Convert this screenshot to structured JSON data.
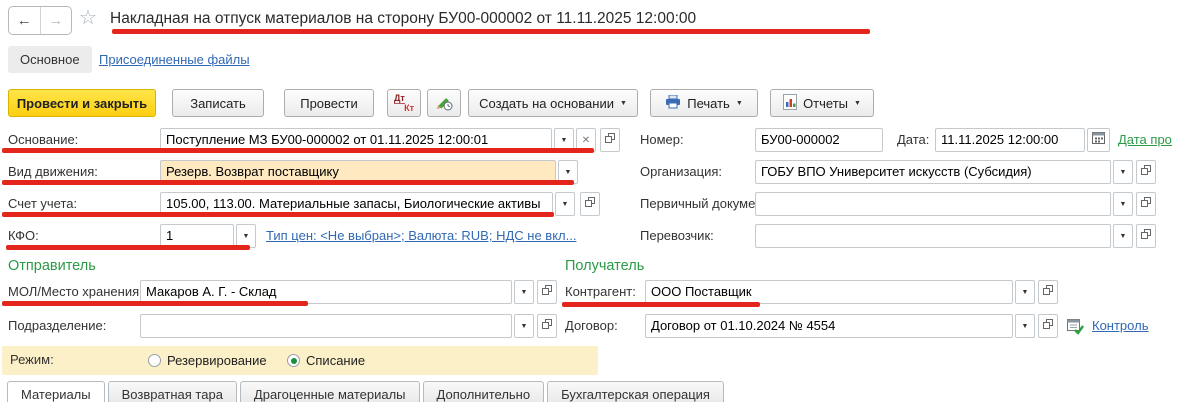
{
  "header": {
    "title": "Накладная на отпуск материалов на сторону БУ00-000002 от 11.11.2025 12:00:00"
  },
  "glyphs": {
    "back": "←",
    "forward": "→",
    "star": "☆",
    "caret": "▼",
    "clear": "✕"
  },
  "nav_tabs": {
    "main": "Основное",
    "files": "Присоединенные файлы"
  },
  "toolbar": {
    "post_close": "Провести и закрыть",
    "save": "Записать",
    "post": "Провести",
    "dt": "Дт",
    "kt": "Кт",
    "create_based_on": "Создать на основании",
    "print": "Печать",
    "reports": "Отчеты"
  },
  "left": {
    "osnovanie_label": "Основание:",
    "osnovanie_value": "Поступление МЗ БУ00-000002 от 01.11.2025 12:00:01",
    "vid_label": "Вид движения:",
    "vid_value": "Резерв. Возврат поставщику",
    "schet_label": "Счет учета:",
    "schet_value": "105.00, 113.00. Материальные запасы, Биологические активы",
    "kfo_label": "КФО:",
    "kfo_value": "1",
    "price_link": "Тип цен: <Не выбран>; Валюта: RUB; НДС не вкл..."
  },
  "right": {
    "nomer_label": "Номер:",
    "nomer_value": "БУ00-000002",
    "data_label": "Дата:",
    "data_value": "11.11.2025 12:00:00",
    "data_link": "Дата про",
    "org_label": "Организация:",
    "org_value": "ГОБУ ВПО Университет искусств (Субсидия)",
    "pervichny_label": "Первичный документ:",
    "pervichny_value": "",
    "perevozchik_label": "Перевозчик:",
    "perevozchik_value": ""
  },
  "sender": {
    "header": "Отправитель",
    "mol_label": "МОЛ/Место хранения:",
    "mol_value": "Макаров А. Г. - Склад",
    "podr_label": "Подразделение:",
    "podr_value": ""
  },
  "receiver": {
    "header": "Получатель",
    "kontragent_label": "Контрагент:",
    "kontragent_value": "ООО Поставщик",
    "dogovor_label": "Договор:",
    "dogovor_value": "Договор от 01.10.2024 № 4554",
    "control_link": "Контроль"
  },
  "mode": {
    "label": "Режим:",
    "option1": "Резервирование",
    "option2": "Списание",
    "selected": "Списание"
  },
  "bottom_tabs": {
    "t1": "Материалы",
    "t2": "Возвратная тара",
    "t3": "Драгоценные материалы",
    "t4": "Дополнительно",
    "t5": "Бухгалтерская операция"
  },
  "colors": {
    "annotation_red": "#e3251c",
    "field_highlight": "#ffe9c0",
    "mode_band": "#fcf0c8",
    "primary_button_yellow": "#fecf12",
    "link_blue": "#3169b5",
    "link_green": "#2b9a47"
  }
}
